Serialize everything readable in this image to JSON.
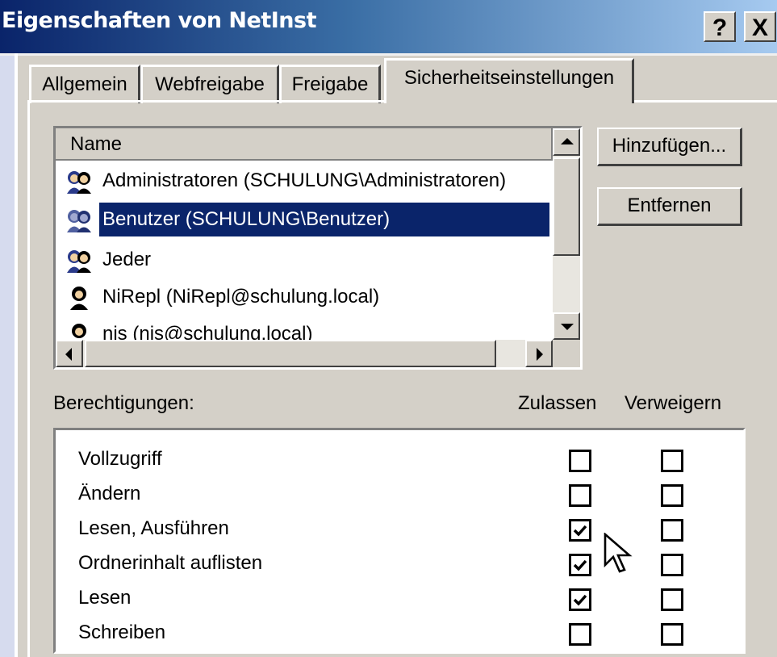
{
  "window": {
    "title": "Eigenschaften von NetInst",
    "help_label": "?",
    "close_label": "X"
  },
  "tabs": [
    {
      "label": "Allgemein",
      "active": false
    },
    {
      "label": "Webfreigabe",
      "active": false
    },
    {
      "label": "Freigabe",
      "active": false
    },
    {
      "label": "Sicherheitseinstellungen",
      "active": true
    }
  ],
  "users": {
    "column_header": "Name",
    "items": [
      {
        "label": "Administratoren (SCHULUNG\\Administratoren)",
        "icon": "group-icon",
        "selected": false
      },
      {
        "label": "Benutzer (SCHULUNG\\Benutzer)",
        "icon": "group-icon",
        "selected": true
      },
      {
        "label": "Jeder",
        "icon": "group-icon",
        "selected": false
      },
      {
        "label": "NiRepl (NiRepl@schulung.local)",
        "icon": "user-icon",
        "selected": false
      },
      {
        "label": "nis (nis@schulung.local)",
        "icon": "user-icon",
        "selected": false
      }
    ]
  },
  "buttons": {
    "add": "Hinzufügen...",
    "remove": "Entfernen"
  },
  "permissions": {
    "label": "Berechtigungen:",
    "allow_header": "Zulassen",
    "deny_header": "Verweigern",
    "rows": [
      {
        "name": "Vollzugriff",
        "allow": false,
        "deny": false
      },
      {
        "name": "Ändern",
        "allow": false,
        "deny": false
      },
      {
        "name": "Lesen, Ausführen",
        "allow": true,
        "deny": false
      },
      {
        "name": "Ordnerinhalt auflisten",
        "allow": true,
        "deny": false
      },
      {
        "name": "Lesen",
        "allow": true,
        "deny": false
      },
      {
        "name": "Schreiben",
        "allow": false,
        "deny": false
      }
    ]
  },
  "colors": {
    "selection": "#0a246a",
    "face": "#d4d0c8"
  }
}
